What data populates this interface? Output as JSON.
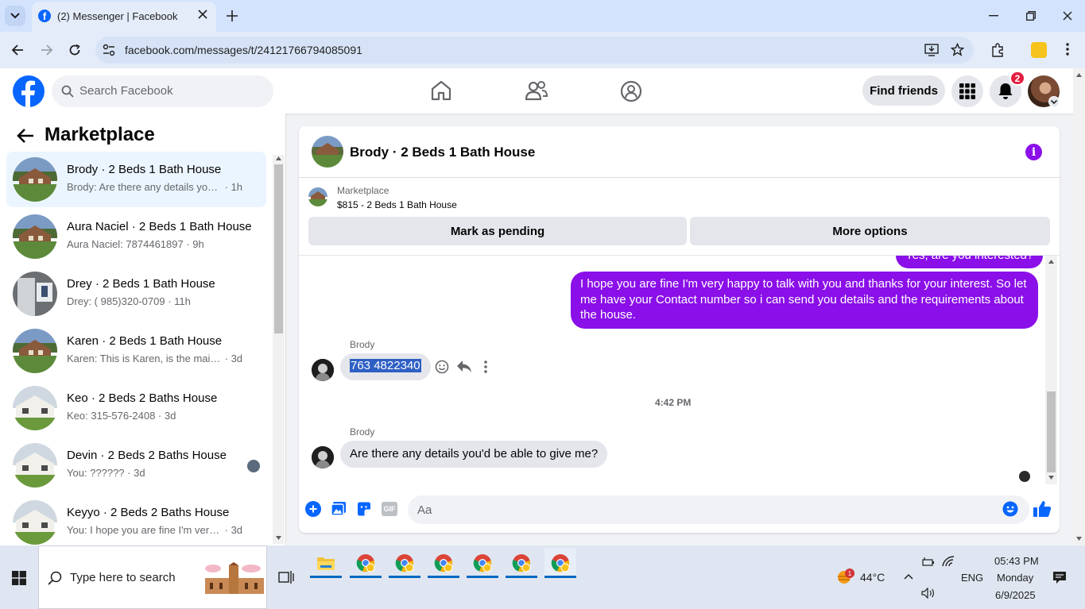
{
  "browser": {
    "tab_title": "(2) Messenger | Facebook",
    "url": "facebook.com/messages/t/24121766794085091"
  },
  "fb_nav": {
    "search_placeholder": "Search Facebook",
    "find_friends": "Find friends",
    "notification_count": "2"
  },
  "sidebar": {
    "title": "Marketplace",
    "conversations": [
      {
        "title": "Brody · 2 Beds 1 Bath House",
        "snippet": "Brody: Are there any details you'd be able to give me?",
        "time": "1h",
        "active": true
      },
      {
        "title": "Aura Naciel · 2 Beds 1 Bath House",
        "snippet": "Aura Naciel: 7874461897",
        "time": "9h"
      },
      {
        "title": "Drey · 2 Beds 1 Bath House",
        "snippet": "Drey: ( 985)320-0709",
        "time": "11h"
      },
      {
        "title": "Karen · 2 Beds 1 Bath House",
        "snippet": "Karen: This is Karen, is the main floor still available",
        "time": "3d"
      },
      {
        "title": "Keo · 2 Beds 2 Baths House",
        "snippet": "Keo: 315-576-2408",
        "time": "3d"
      },
      {
        "title": "Devin · 2 Beds 2 Baths House",
        "snippet": "You: ??????",
        "time": "3d"
      },
      {
        "title": "Keyyo · 2 Beds 2 Baths House",
        "snippet": "You: I hope you are fine I'm very happy to talk with you",
        "time": "3d"
      }
    ]
  },
  "chat": {
    "title": "Brody · 2 Beds 1 Bath House",
    "marketplace_label": "Marketplace",
    "listing": "$815 - 2 Beds 1 Bath House",
    "mark_pending": "Mark as pending",
    "more_options": "More options",
    "partial_message": "Yes, are you interested?",
    "outgoing_message": "I hope you are fine I'm very happy to talk with you and thanks for your interest. So let me have your Contact number so i can send you details and the requirements about the house.",
    "sender_1": "Brody",
    "phone_message": "763 4822340",
    "timestamp": "4:42 PM",
    "sender_2": "Brody",
    "last_message": "Are there any details you'd be able to give me?",
    "composer_placeholder": "Aa"
  },
  "taskbar": {
    "search_placeholder": "Type here to search",
    "weather_temp": "44°C",
    "weather_badge": "1",
    "language": "ENG",
    "time": "05:43 PM",
    "day": "Monday",
    "date": "6/9/2025"
  },
  "colors": {
    "fb_blue": "#0866ff",
    "messenger_purple": "#8a0fe8",
    "notification_red": "#e41e3f",
    "selection_blue": "#2e5fc4"
  }
}
